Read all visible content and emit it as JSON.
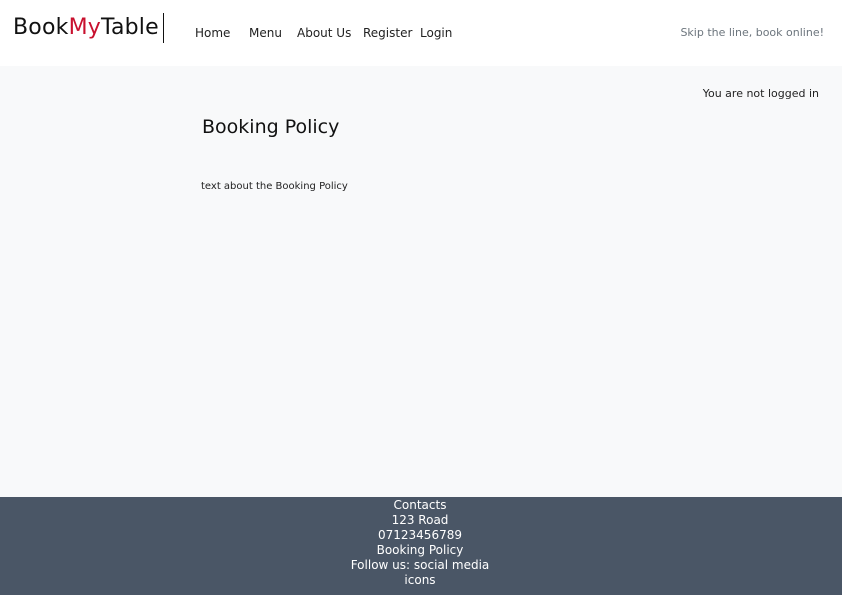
{
  "header": {
    "brand": {
      "part1": "Book",
      "part2": "My",
      "part3": "Table"
    },
    "nav": [
      {
        "label": "Home"
      },
      {
        "label": "Menu"
      },
      {
        "label": "About Us"
      },
      {
        "label": "Register"
      },
      {
        "label": "Login"
      }
    ],
    "tagline": "Skip the line, book online!"
  },
  "main": {
    "login_status": "You are not logged in",
    "title": "Booking Policy",
    "body": "text about the Booking Policy"
  },
  "footer": {
    "contacts_label": "Contacts",
    "address": "123 Road",
    "phone": "07123456789",
    "policy_link": "Booking Policy",
    "follow": "Follow us: social media icons"
  },
  "colors": {
    "brand_accent": "#c8102e",
    "footer_bg": "#4a5666",
    "page_bg": "#f8f9fa"
  }
}
